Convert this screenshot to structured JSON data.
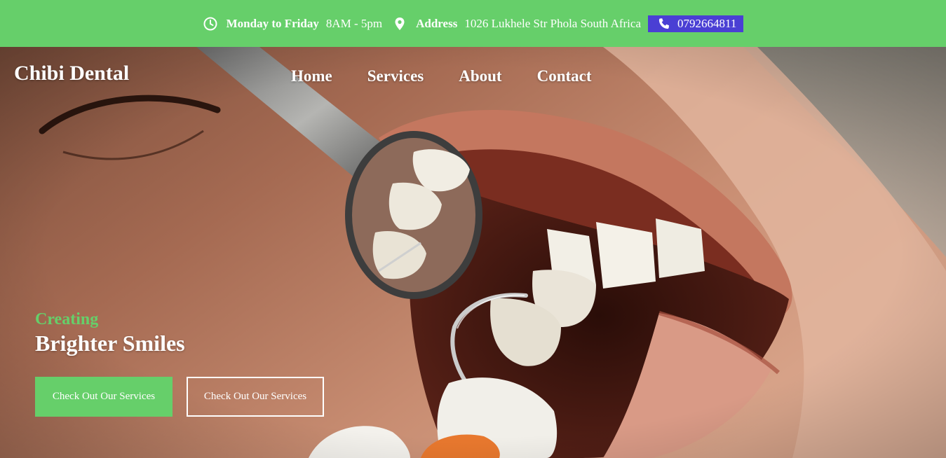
{
  "topbar": {
    "hours_label": "Monday to Friday",
    "hours_value": "8AM - 5pm",
    "address_label": "Address",
    "address_value": "1026 Lukhele Str Phola South Africa",
    "phone": "0792664811",
    "icons": [
      "clock-icon",
      "location-pin-icon",
      "phone-icon"
    ]
  },
  "brand": "Chibi Dental",
  "nav": {
    "items": [
      "Home",
      "Services",
      "About",
      "Contact"
    ]
  },
  "hero": {
    "kicker": "Creating",
    "headline": "Brighter Smiles",
    "primary_button": "Check Out Our Services",
    "secondary_button": "Check Out Our Services"
  },
  "colors": {
    "accent_green": "#66cf6a",
    "phone_bg": "#4a3fd4",
    "text": "#ffffff"
  }
}
